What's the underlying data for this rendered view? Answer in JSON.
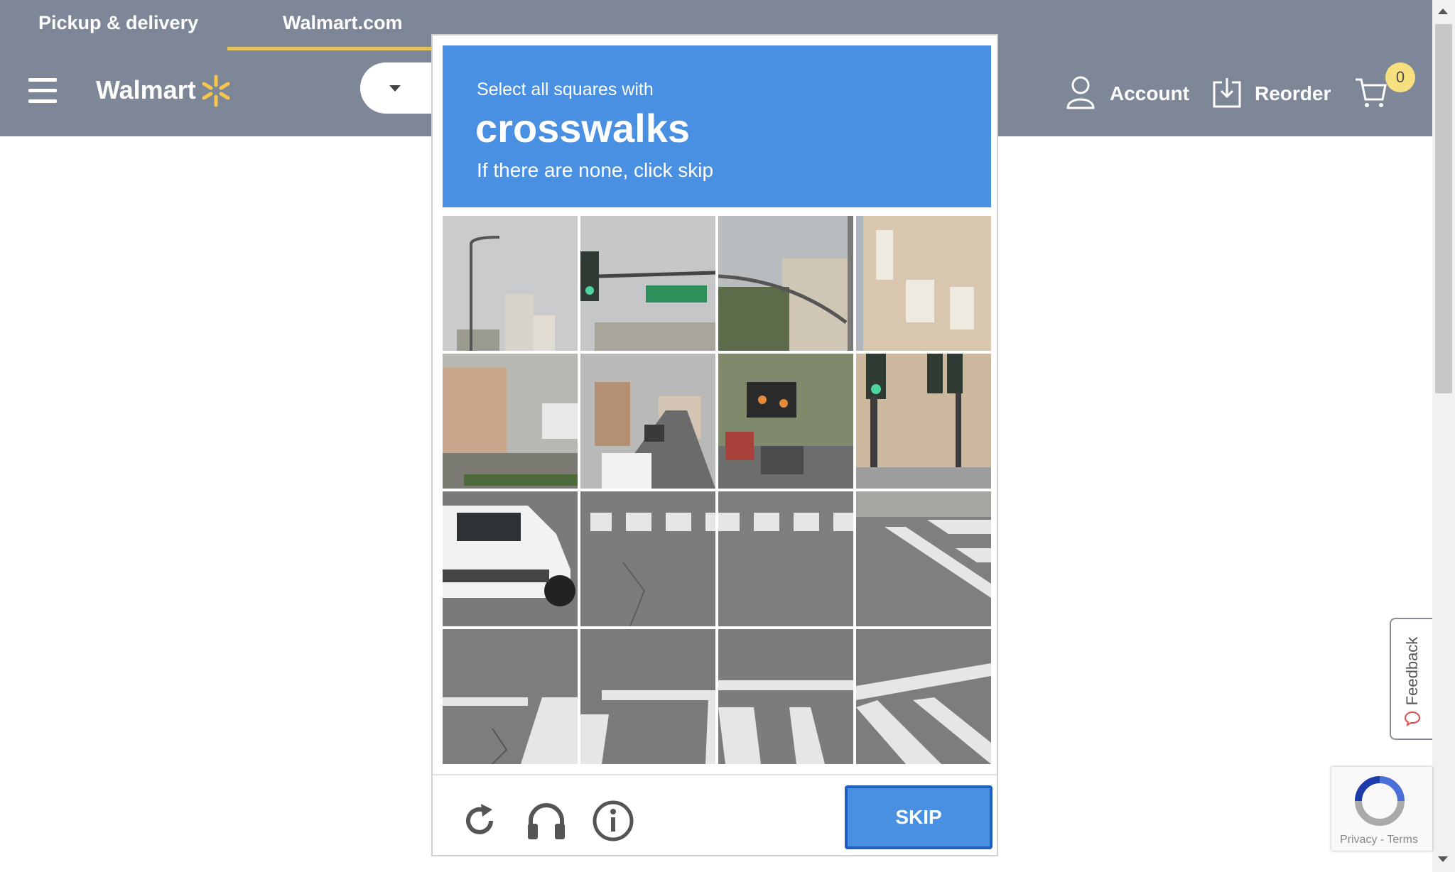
{
  "header": {
    "tabs": [
      {
        "label": "Pickup & delivery"
      },
      {
        "label": "Walmart.com"
      }
    ],
    "logo_text": "Walmart",
    "account_label": "Account",
    "reorder_label": "Reorder",
    "cart_count": "0"
  },
  "captcha": {
    "instruction_line1": "Select all squares with",
    "target_word": "crosswalks",
    "instruction_line3": "If there are none, click skip",
    "grid_rows": 4,
    "grid_cols": 4,
    "skip_label": "SKIP",
    "accent_color": "#4a90e2"
  },
  "feedback": {
    "label": "Feedback"
  },
  "recaptcha": {
    "links": "Privacy - Terms"
  },
  "colors": {
    "header_bg": "#7e8797",
    "tab_underline": "#e6c35c",
    "badge": "#f6df7f"
  }
}
